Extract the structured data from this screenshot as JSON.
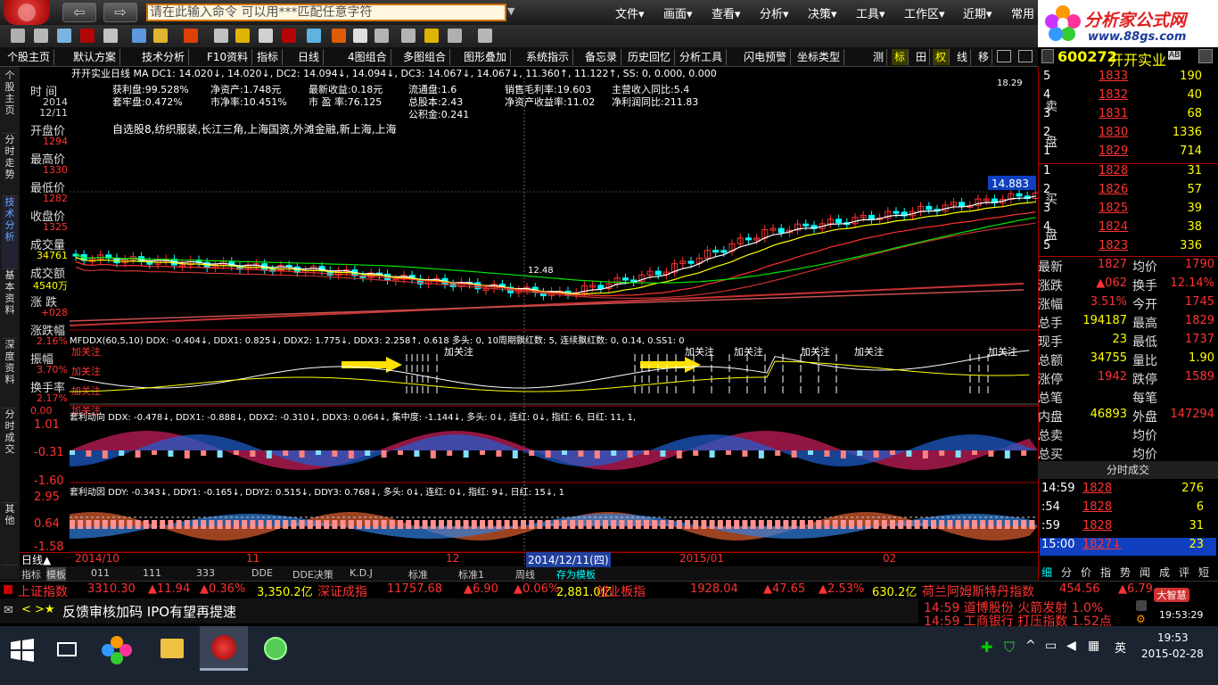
{
  "window": {
    "command_placeholder": "请在此输入命令    可以用***匹配任意字符",
    "menus": [
      "文件▾",
      "画面▾",
      "查看▾",
      "分析▾",
      "决策▾",
      "工具▾",
      "工作区▾",
      "近期▾",
      "常用"
    ]
  },
  "ad": {
    "title": "分析家公式网",
    "url": "www.88gs.com"
  },
  "tabs": [
    "个股主页",
    "默认方案",
    "技术分析",
    "F10资料",
    "指标",
    "日线",
    "4图组合",
    "多图组合",
    "图形叠加",
    "系统指示",
    "备忘录",
    "历史回忆",
    "分析工具",
    "闪电预警",
    "坐标类型"
  ],
  "tabs_right": [
    "测",
    "标",
    "田",
    "权",
    "线",
    "移"
  ],
  "stock": {
    "code": "600272",
    "name": "开开实业",
    "badge": "AB"
  },
  "sidebar": [
    "个股主页",
    "分时走势",
    "技术分析",
    "基本资料",
    "深度资料",
    "分时成交",
    "其他"
  ],
  "info": {
    "time_label": "时 间",
    "time_year": "2014",
    "time_date": "12/11",
    "open_label": "开盘价",
    "open": "1294",
    "high_label": "最高价",
    "high": "1330",
    "low_label": "最低价",
    "low": "1282",
    "close_label": "收盘价",
    "close": "1325",
    "vol_label": "成交量",
    "vol": "34761",
    "amount_label": "成交额",
    "amount": "4540万",
    "chg_label": "涨 跌",
    "chg": "+028",
    "pct_label": "涨跌幅",
    "pct": "2.16%",
    "amp_label": "振幅",
    "amp": "3.70%",
    "turn_label": "换手率",
    "turn": "2.17%"
  },
  "chart": {
    "ma_line": "开开实业日线  MA DC1: 14.020↓, 14.020↓, DC2: 14.094↓, 14.094↓, DC3: 14.067↓, 14.067↓, 11.360↑, 11.122↑, SS: 0, 0.000, 0.000",
    "stats": [
      [
        "获利盘:99.528%",
        "净资产:1.748元",
        "最新收益:0.18元",
        "流通盘:1.6",
        "销售毛利率:19.603",
        "主营收入同比:5.4"
      ],
      [
        "套牢盘:0.472%",
        "市净率:10.451%",
        "市 盈 率:76.125",
        "总股本:2.43",
        "净资产收益率:11.02",
        "净利润同比:211.83"
      ],
      [
        "",
        "",
        "",
        "公积金:0.241",
        "",
        ""
      ]
    ],
    "tags": "自选股8,纺织服装,长江三角,上海国资,外滩金融,新上海,上海",
    "high_mark": "18.29",
    "low_mark": "12.48",
    "price_flag": "14.883",
    "ddx_line": "MFDDX(60,5,10) DDX: -0.404↓, DDX1: 0.825↓, DDX2: 1.775↓, DDX3: 2.258↑,    0.618  多头: 0,  10周期飘红数: 5, 连续飘红数: 0,    0.14, 0.SS1: 0",
    "ddx_scale": [
      "2.16",
      "3.70",
      "2.17",
      "0.00"
    ],
    "attention": "加关注",
    "arb_line": "套利动向 DDX: -0.478↓, DDX1: -0.888↓, DDX2: -0.310↓, DDX3: 0.064↓, 集中度: -1.144↓, 多头: 0↓, 连红: 0↓, 指红: 6, 日红: 11, 1,",
    "arb_scale": [
      "1.01",
      "-0.31",
      "-1.60"
    ],
    "cause_line": "套利动因 DDY: -0.343↓, DDY1: -0.165↓, DDY2: 0.515↓, DDY3: 0.768↓, 多头: 0↓, 连红: 0↓, 指红: 9↓, 日红: 15↓, 1",
    "cause_scale": [
      "2.95",
      "0.64",
      "-1.58"
    ],
    "date_axis": [
      "日线▲",
      "2014/10",
      "11",
      "12",
      "2014/12/11(四)",
      "2015/01",
      "02"
    ],
    "bottom_tabs": [
      "指标",
      "模板",
      "011",
      "111",
      "333",
      "DDE",
      "DDE决策",
      "K.D.J",
      "标准",
      "标准1",
      "周线",
      "存为模板"
    ]
  },
  "orderbook": {
    "asks": [
      [
        "5",
        "1833",
        "190"
      ],
      [
        "4",
        "1832",
        "40"
      ],
      [
        "3",
        "1831",
        "68"
      ],
      [
        "2",
        "1830",
        "1336"
      ],
      [
        "1",
        "1829",
        "714"
      ]
    ],
    "bids": [
      [
        "1",
        "1828",
        "31"
      ],
      [
        "2",
        "1826",
        "57"
      ],
      [
        "3",
        "1825",
        "39"
      ],
      [
        "4",
        "1824",
        "38"
      ],
      [
        "5",
        "1823",
        "336"
      ]
    ],
    "sell_label": "卖 盘",
    "buy_label": "买 盘",
    "price_tag": "14.883"
  },
  "quote": [
    [
      "最新",
      "1827",
      "均价",
      "1790"
    ],
    [
      "涨跌",
      "▲062",
      "换手",
      "12.14%"
    ],
    [
      "涨幅",
      "3.51%",
      "今开",
      "1745"
    ],
    [
      "总手",
      "194187",
      "最高",
      "1829"
    ],
    [
      "现手",
      "23",
      "最低",
      "1737"
    ],
    [
      "总额",
      "34755",
      "量比",
      "1.90"
    ],
    [
      "涨停",
      "1942",
      "跌停",
      "1589"
    ],
    [
      "总笔",
      "",
      "每笔",
      ""
    ],
    [
      "内盘",
      "46893",
      "外盘",
      "147294"
    ],
    [
      "总卖",
      "",
      "均价",
      ""
    ],
    [
      "总买",
      "",
      "均价",
      ""
    ]
  ],
  "ticks": {
    "title": "分时成交",
    "rows": [
      [
        "14:59",
        "1828",
        "276"
      ],
      [
        ":54",
        "1828",
        "6"
      ],
      [
        ":59",
        "1828",
        "31"
      ],
      [
        "15:00",
        "1827↓",
        "23"
      ]
    ]
  },
  "right_tabs": [
    "细",
    "分",
    "价",
    "指",
    "势",
    "闻",
    "成",
    "评",
    "短"
  ],
  "ticker": [
    [
      "上证指数",
      "3310.30",
      "▲11.94",
      "▲0.36%",
      "3,350.2亿"
    ],
    [
      "深证成指",
      "11757.68",
      "▲6.90",
      "▲0.06%",
      "2,881.0亿"
    ],
    [
      "创业板指",
      "1928.04",
      "▲47.65",
      "▲2.53%",
      "630.2亿"
    ],
    [
      "荷兰阿姆斯特丹指数",
      "454.56",
      "▲6.79",
      ""
    ]
  ],
  "news": {
    "text": "反馈审核加码 IPO有望再提速",
    "alert1": "14:59 道博股份 火箭发射 1.0%",
    "alert2": "14:59 工商银行 打压指数 1.52点",
    "brand": "大智慧",
    "time": "19:53:29"
  },
  "taskbar": {
    "time": "19:53",
    "date": "2015-02-28",
    "ime": "英"
  }
}
